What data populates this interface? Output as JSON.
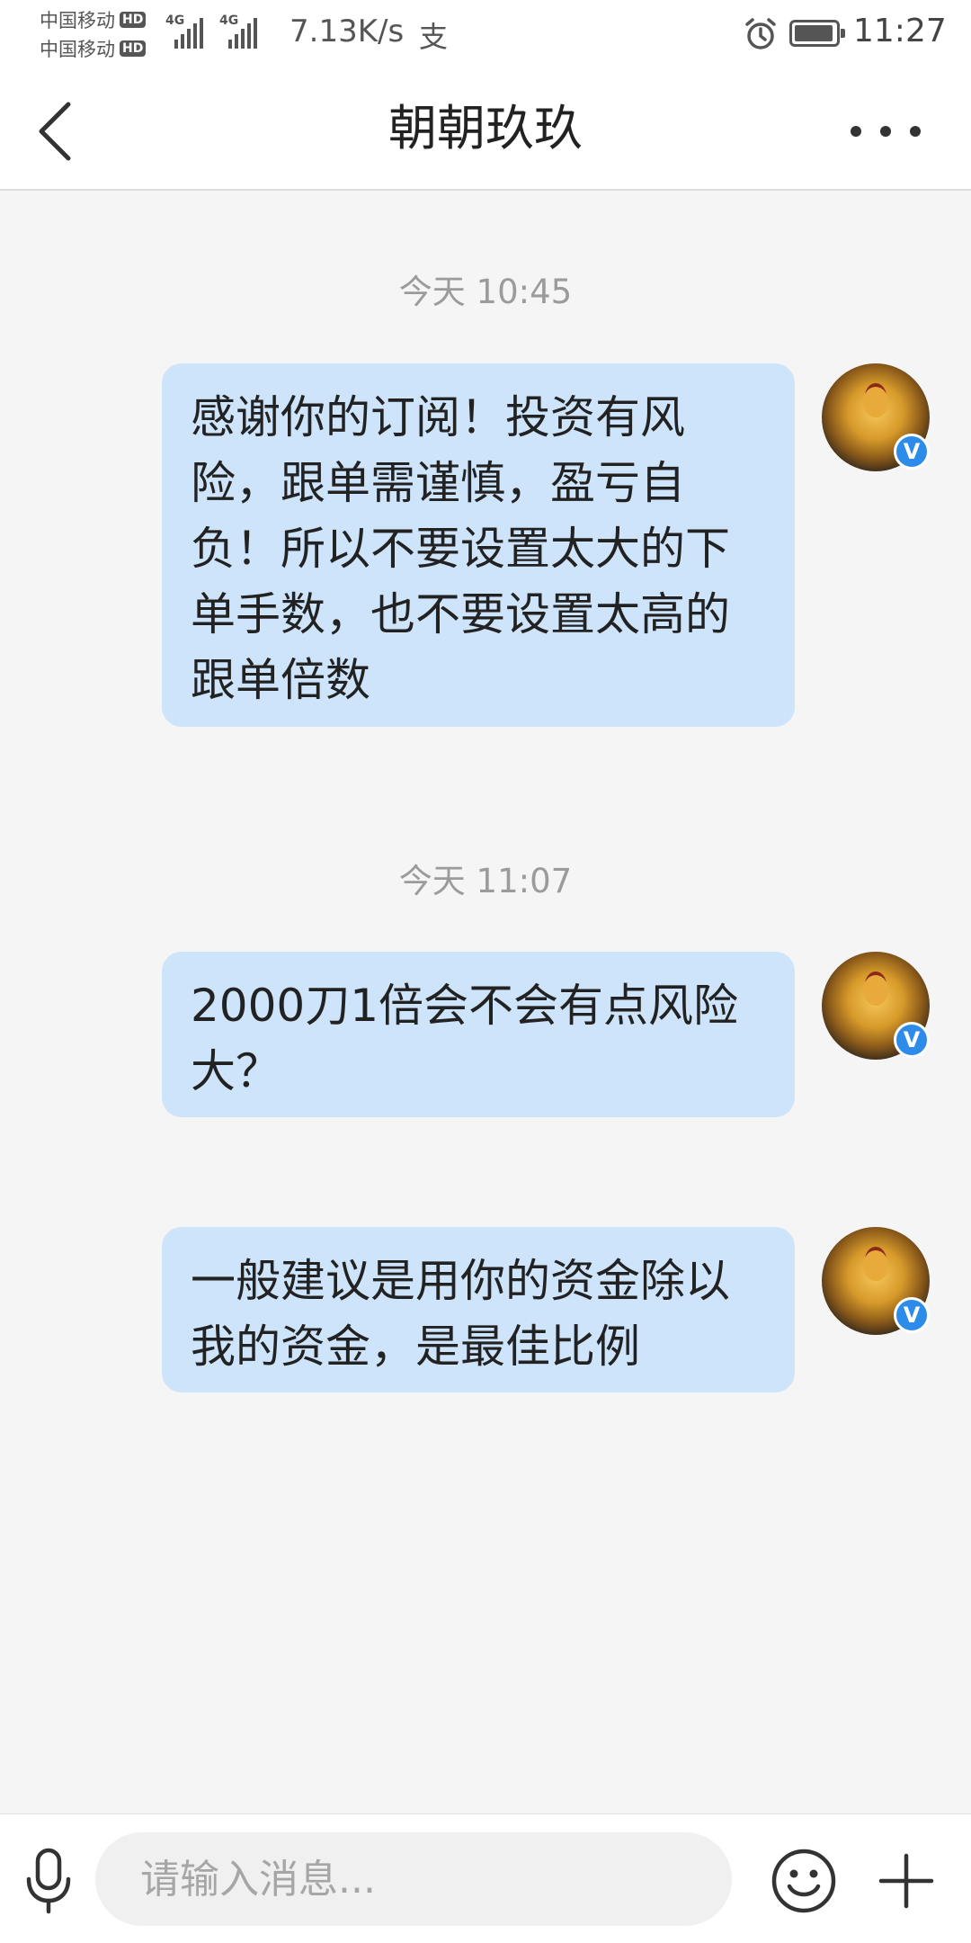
{
  "status_bar": {
    "carrier_1": "中国移动",
    "carrier_2": "中国移动",
    "hd_badge": "HD",
    "network_1": "4G",
    "network_2": "4G",
    "net_speed": "7.13K/s",
    "notification_glyph": "支",
    "time": "11:27",
    "icons": [
      "signal-icon",
      "signal-icon",
      "alarm-icon",
      "battery-icon"
    ]
  },
  "nav": {
    "title": "朝朝玖玖",
    "back_icon": "chevron-left-icon",
    "more_icon": "more-dots-icon"
  },
  "chat": {
    "timestamps": [
      "今天 10:45",
      "今天 11:07"
    ],
    "messages": [
      {
        "text": "感谢你的订阅！投资有风险，跟单需谨慎，盈亏自负！所以不要设置太大的下单手数，也不要设置太高的跟单倍数",
        "verified": "V"
      },
      {
        "text": "2000刀1倍会不会有点风险大？",
        "verified": "V"
      },
      {
        "text": "一般建议是用你的资金除以我的资金，是最佳比例",
        "verified": "V"
      }
    ],
    "bubble_color": "#cde4fb"
  },
  "input_bar": {
    "placeholder": "请输入消息...",
    "voice_icon": "microphone-icon",
    "emoji_icon": "emoji-icon",
    "plus_icon": "plus-icon"
  }
}
